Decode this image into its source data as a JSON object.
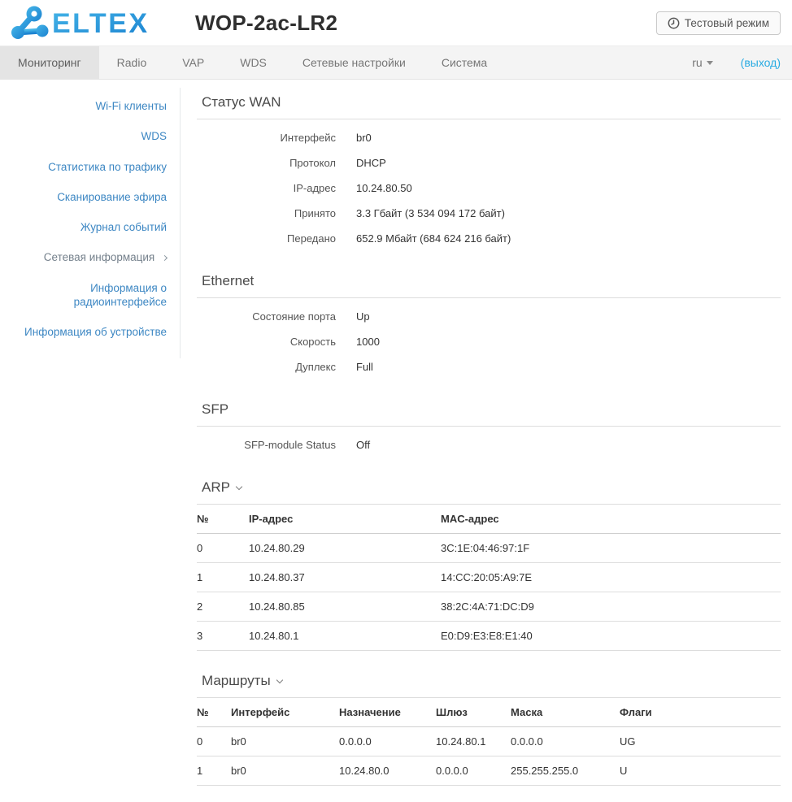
{
  "colors": {
    "brand_blue": "#2698dc",
    "sidebar_link_blue": "#3d87c3",
    "logout_cyan": "#29abe2",
    "nav_bg": "#f4f4f4",
    "nav_active_bg": "#e4e4e4"
  },
  "icons": {
    "clock": "clock-icon",
    "chevron_down": "chevron-down-icon",
    "chevron_right": "chevron-right-icon",
    "caret_down": "caret-down-icon"
  },
  "header": {
    "logo_text": "ELTEX",
    "device_title": "WOP-2ac-LR2",
    "test_mode_button": "Тестовый режим"
  },
  "navbar": {
    "tabs": [
      {
        "label": "Мониторинг"
      },
      {
        "label": "Radio"
      },
      {
        "label": "VAP"
      },
      {
        "label": "WDS"
      },
      {
        "label": "Сетевые настройки"
      },
      {
        "label": "Система"
      }
    ],
    "language": "ru",
    "logout_label": "(выход)"
  },
  "sidebar": {
    "items": [
      {
        "label": "Wi-Fi клиенты"
      },
      {
        "label": "WDS"
      },
      {
        "label": "Статистика по трафику"
      },
      {
        "label": "Сканирование эфира"
      },
      {
        "label": "Журнал событий"
      },
      {
        "label": "Сетевая информация"
      },
      {
        "label": "Информация о радиоинтерфейсе"
      },
      {
        "label": "Информация об устройстве"
      }
    ]
  },
  "main": {
    "wan": {
      "title": "Статус WAN",
      "rows": [
        {
          "label": "Интерфейс",
          "value": "br0"
        },
        {
          "label": "Протокол",
          "value": "DHCP"
        },
        {
          "label": "IP-адрес",
          "value": "10.24.80.50"
        },
        {
          "label": "Принято",
          "value": "3.3 Гбайт (3 534 094 172 байт)"
        },
        {
          "label": "Передано",
          "value": "652.9 Мбайт (684 624 216 байт)"
        }
      ]
    },
    "ethernet": {
      "title": "Ethernet",
      "rows": [
        {
          "label": "Состояние порта",
          "value": "Up"
        },
        {
          "label": "Скорость",
          "value": "1000"
        },
        {
          "label": "Дуплекс",
          "value": "Full"
        }
      ]
    },
    "sfp": {
      "title": "SFP",
      "rows": [
        {
          "label": "SFP-module Status",
          "value": "Off"
        }
      ]
    },
    "arp": {
      "title": "ARP",
      "columns": [
        "№",
        "IP-адрес",
        "MAC-адрес"
      ],
      "rows": [
        [
          "0",
          "10.24.80.29",
          "3C:1E:04:46:97:1F"
        ],
        [
          "1",
          "10.24.80.37",
          "14:CC:20:05:A9:7E"
        ],
        [
          "2",
          "10.24.80.85",
          "38:2C:4A:71:DC:D9"
        ],
        [
          "3",
          "10.24.80.1",
          "E0:D9:E3:E8:E1:40"
        ]
      ]
    },
    "routes": {
      "title": "Маршруты",
      "columns": [
        "№",
        "Интерфейс",
        "Назначение",
        "Шлюз",
        "Маска",
        "Флаги"
      ],
      "rows": [
        [
          "0",
          "br0",
          "0.0.0.0",
          "10.24.80.1",
          "0.0.0.0",
          "UG"
        ],
        [
          "1",
          "br0",
          "10.24.80.0",
          "0.0.0.0",
          "255.255.255.0",
          "U"
        ]
      ]
    }
  }
}
